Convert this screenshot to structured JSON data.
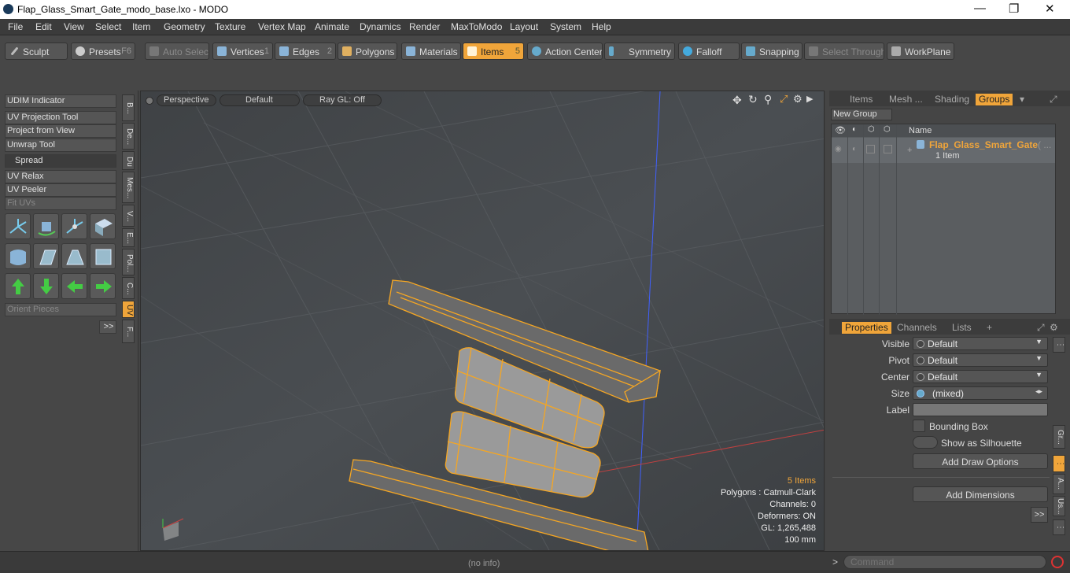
{
  "window": {
    "title": "Flap_Glass_Smart_Gate_modo_base.lxo - MODO",
    "minimize": "—",
    "maximize": "❐",
    "close": "✕"
  },
  "menu": [
    "File",
    "Edit",
    "View",
    "Select",
    "Item",
    "Geometry",
    "Texture",
    "Vertex Map",
    "Animate",
    "Dynamics",
    "Render",
    "MaxToModo",
    "Layout",
    "System",
    "Help"
  ],
  "toolbar": {
    "sculpt": "Sculpt",
    "presets": "Presets",
    "presets_key": "F6",
    "auto_select": "Auto Select",
    "vertices": "Vertices",
    "vertices_key": "1",
    "edges": "Edges",
    "edges_key": "2",
    "polygons": "Polygons",
    "materials": "Materials",
    "items": "Items",
    "items_key": "5",
    "action_center": "Action Center",
    "symmetry": "Symmetry",
    "falloff": "Falloff",
    "snapping": "Snapping",
    "select_through": "Select Through",
    "workplane": "WorkPlane"
  },
  "left_tools": {
    "udim": "UDIM Indicator",
    "uv_projection": "UV Projection Tool",
    "project_from_view": "Project from View",
    "unwrap": "Unwrap Tool",
    "spread": "Spread",
    "uv_relax": "UV Relax",
    "uv_peeler": "UV Peeler",
    "fit_uvs": "Fit UVs",
    "orient_pieces": "Orient Pieces",
    "more": ">>"
  },
  "vertical_tabs": [
    "B...",
    "De...",
    "Du",
    "Mes...",
    "V...",
    "E...",
    "Pol...",
    "C...",
    "UV",
    "F..."
  ],
  "viewport": {
    "perspective": "Perspective",
    "default": "Default",
    "raygl": "Ray GL: Off",
    "hud": {
      "items": "5 Items",
      "polygons": "Polygons : Catmull-Clark",
      "channels": "Channels: 0",
      "deformers": "Deformers: ON",
      "gl": "GL: 1,265,488",
      "scale": "100 mm"
    }
  },
  "status": "(no info)",
  "groups_panel": {
    "tabs": [
      "Items",
      "Mesh ...",
      "Shading",
      "Groups"
    ],
    "new_group": "New Group",
    "name_header": "Name",
    "group_name": "Flap_Glass_Smart_Gate",
    "group_suffix": "( ...",
    "group_count": "1 Item"
  },
  "properties_panel": {
    "tabs": [
      "Properties",
      "Channels",
      "Lists",
      "+"
    ],
    "visible_label": "Visible",
    "visible_value": "Default",
    "pivot_label": "Pivot",
    "pivot_value": "Default",
    "center_label": "Center",
    "center_value": "Default",
    "size_label": "Size",
    "size_value": "(mixed)",
    "label_label": "Label",
    "bounding_box": "Bounding Box",
    "silhouette": "Show as Silhouette",
    "add_draw": "Add Draw Options",
    "add_dims": "Add Dimensions",
    "more": ">>",
    "side_tabs": [
      "Gr...",
      "A...",
      "Us..."
    ]
  },
  "command": {
    "placeholder": "Command",
    "prompt": ">"
  },
  "colors": {
    "accent": "#f0a53a",
    "wire": "#f5a623"
  }
}
